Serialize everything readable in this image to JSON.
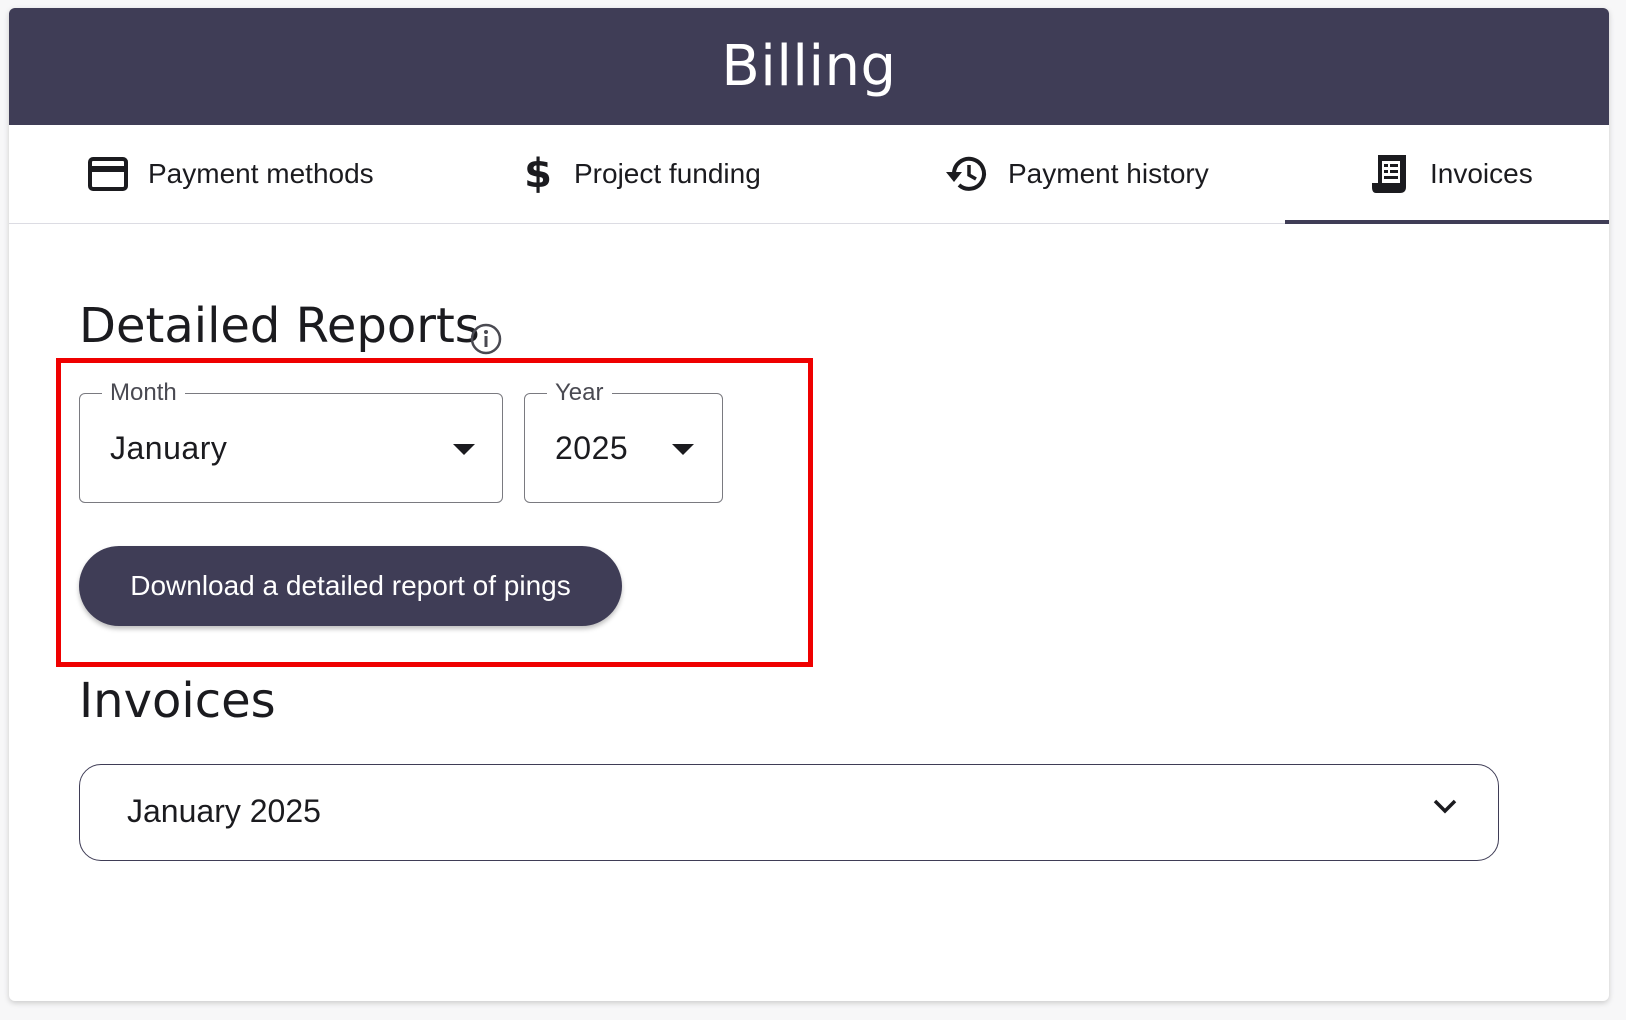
{
  "header": {
    "title": "Billing"
  },
  "tabs": [
    {
      "label": "Payment methods",
      "icon": "credit-card-icon"
    },
    {
      "label": "Project funding",
      "icon": "dollar-icon"
    },
    {
      "label": "Payment history",
      "icon": "history-icon"
    },
    {
      "label": "Invoices",
      "icon": "receipt-icon",
      "selected": true
    }
  ],
  "detailed_reports": {
    "title": "Detailed Reports",
    "info_icon": "info-icon",
    "month": {
      "label": "Month",
      "value": "January"
    },
    "year": {
      "label": "Year",
      "value": "2025"
    },
    "download_button": "Download a detailed report of pings"
  },
  "invoices": {
    "title": "Invoices",
    "items": [
      {
        "label": "January 2025",
        "expanded": false
      }
    ]
  },
  "colors": {
    "primary": "#3f3d56",
    "highlight": "#ef0000",
    "background": "#ffffff"
  }
}
